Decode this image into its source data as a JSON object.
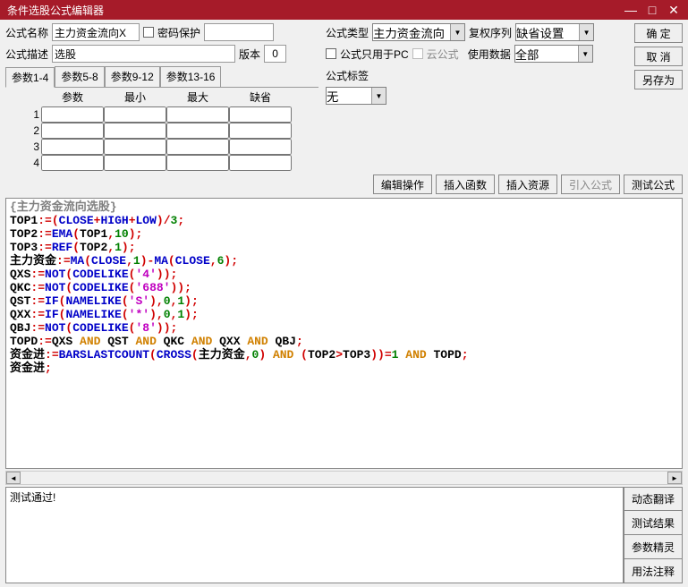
{
  "window": {
    "title": "条件选股公式编辑器"
  },
  "labels": {
    "formula_name": "公式名称",
    "pwd_protect": "密码保护",
    "formula_desc": "公式描述",
    "version": "版本",
    "formula_type": "公式类型",
    "restore_seq": "复权序列",
    "only_pc": "公式只用于PC",
    "cloud": "云公式",
    "use_data": "使用数据",
    "formula_tag": "公式标签",
    "param_cols": [
      "参数",
      "最小",
      "最大",
      "缺省"
    ],
    "tabs": [
      "参数1-4",
      "参数5-8",
      "参数9-12",
      "参数13-16"
    ],
    "row_nums": [
      "1",
      "2",
      "3",
      "4"
    ]
  },
  "values": {
    "formula_name": "主力资金流向X",
    "formula_desc": "选股",
    "version": "0",
    "formula_type": "主力资金流向",
    "restore_seq": "缺省设置",
    "use_data": "全部",
    "formula_tag": "无",
    "pwd_field": ""
  },
  "buttons": {
    "ok": "确 定",
    "cancel": "取 消",
    "save_as": "另存为",
    "edit_op": "编辑操作",
    "insert_func": "插入函数",
    "insert_res": "插入资源",
    "import_formula": "引入公式",
    "test_formula": "测试公式",
    "dyn_trans": "动态翻译",
    "test_result": "测试结果",
    "param_wizard": "参数精灵",
    "usage_note": "用法注释"
  },
  "status": {
    "msg": "测试通过!"
  },
  "code": {
    "title": "{主力资金流向选股}",
    "lines": [
      [
        [
          "black",
          "TOP1"
        ],
        [
          "red",
          ":="
        ],
        [
          "red",
          "("
        ],
        [
          "blue",
          "CLOSE"
        ],
        [
          "red",
          "+"
        ],
        [
          "blue",
          "HIGH"
        ],
        [
          "red",
          "+"
        ],
        [
          "blue",
          "LOW"
        ],
        [
          "red",
          ")"
        ],
        [
          "red",
          "/"
        ],
        [
          "green",
          "3"
        ],
        [
          "red",
          ";"
        ]
      ],
      [
        [
          "black",
          "TOP2"
        ],
        [
          "red",
          ":="
        ],
        [
          "blue",
          "EMA"
        ],
        [
          "red",
          "("
        ],
        [
          "black",
          "TOP1"
        ],
        [
          "red",
          ","
        ],
        [
          "green",
          "10"
        ],
        [
          "red",
          ")"
        ],
        [
          "red",
          ";"
        ]
      ],
      [
        [
          "black",
          "TOP3"
        ],
        [
          "red",
          ":="
        ],
        [
          "blue",
          "REF"
        ],
        [
          "red",
          "("
        ],
        [
          "black",
          "TOP2"
        ],
        [
          "red",
          ","
        ],
        [
          "green",
          "1"
        ],
        [
          "red",
          ")"
        ],
        [
          "red",
          ";"
        ]
      ],
      [
        [
          "black",
          "主力资金"
        ],
        [
          "red",
          ":="
        ],
        [
          "blue",
          "MA"
        ],
        [
          "red",
          "("
        ],
        [
          "blue",
          "CLOSE"
        ],
        [
          "red",
          ","
        ],
        [
          "green",
          "1"
        ],
        [
          "red",
          ")"
        ],
        [
          "red",
          "-"
        ],
        [
          "blue",
          "MA"
        ],
        [
          "red",
          "("
        ],
        [
          "blue",
          "CLOSE"
        ],
        [
          "red",
          ","
        ],
        [
          "green",
          "6"
        ],
        [
          "red",
          ")"
        ],
        [
          "red",
          ";"
        ]
      ],
      [
        [
          "black",
          "QXS"
        ],
        [
          "red",
          ":="
        ],
        [
          "blue",
          "NOT"
        ],
        [
          "red",
          "("
        ],
        [
          "blue",
          "CODELIKE"
        ],
        [
          "red",
          "("
        ],
        [
          "magenta",
          "'4'"
        ],
        [
          "red",
          ")"
        ],
        [
          "red",
          ")"
        ],
        [
          "red",
          ";"
        ]
      ],
      [
        [
          "black",
          "QKC"
        ],
        [
          "red",
          ":="
        ],
        [
          "blue",
          "NOT"
        ],
        [
          "red",
          "("
        ],
        [
          "blue",
          "CODELIKE"
        ],
        [
          "red",
          "("
        ],
        [
          "magenta",
          "'688'"
        ],
        [
          "red",
          ")"
        ],
        [
          "red",
          ")"
        ],
        [
          "red",
          ";"
        ]
      ],
      [
        [
          "black",
          "QST"
        ],
        [
          "red",
          ":="
        ],
        [
          "blue",
          "IF"
        ],
        [
          "red",
          "("
        ],
        [
          "blue",
          "NAMELIKE"
        ],
        [
          "red",
          "("
        ],
        [
          "magenta",
          "'S'"
        ],
        [
          "red",
          ")"
        ],
        [
          "red",
          ","
        ],
        [
          "green",
          "0"
        ],
        [
          "red",
          ","
        ],
        [
          "green",
          "1"
        ],
        [
          "red",
          ")"
        ],
        [
          "red",
          ";"
        ]
      ],
      [
        [
          "black",
          "QXX"
        ],
        [
          "red",
          ":="
        ],
        [
          "blue",
          "IF"
        ],
        [
          "red",
          "("
        ],
        [
          "blue",
          "NAMELIKE"
        ],
        [
          "red",
          "("
        ],
        [
          "magenta",
          "'*'"
        ],
        [
          "red",
          ")"
        ],
        [
          "red",
          ","
        ],
        [
          "green",
          "0"
        ],
        [
          "red",
          ","
        ],
        [
          "green",
          "1"
        ],
        [
          "red",
          ")"
        ],
        [
          "red",
          ";"
        ]
      ],
      [
        [
          "black",
          "QBJ"
        ],
        [
          "red",
          ":="
        ],
        [
          "blue",
          "NOT"
        ],
        [
          "red",
          "("
        ],
        [
          "blue",
          "CODELIKE"
        ],
        [
          "red",
          "("
        ],
        [
          "magenta",
          "'8'"
        ],
        [
          "red",
          ")"
        ],
        [
          "red",
          ")"
        ],
        [
          "red",
          ";"
        ]
      ],
      [
        [
          "black",
          "TOPD"
        ],
        [
          "red",
          ":="
        ],
        [
          "black",
          "QXS "
        ],
        [
          "orange",
          "AND"
        ],
        [
          "black",
          " QST "
        ],
        [
          "orange",
          "AND"
        ],
        [
          "black",
          " QKC "
        ],
        [
          "orange",
          "AND"
        ],
        [
          "black",
          " QXX "
        ],
        [
          "orange",
          "AND"
        ],
        [
          "black",
          " QBJ"
        ],
        [
          "red",
          ";"
        ]
      ],
      [
        [
          "black",
          "资金进"
        ],
        [
          "red",
          ":="
        ],
        [
          "blue",
          "BARSLASTCOUNT"
        ],
        [
          "red",
          "("
        ],
        [
          "blue",
          "CROSS"
        ],
        [
          "red",
          "("
        ],
        [
          "black",
          "主力资金"
        ],
        [
          "red",
          ","
        ],
        [
          "green",
          "0"
        ],
        [
          "red",
          ")"
        ],
        [
          "black",
          " "
        ],
        [
          "orange",
          "AND"
        ],
        [
          "black",
          " "
        ],
        [
          "red",
          "("
        ],
        [
          "black",
          "TOP2"
        ],
        [
          "red",
          ">"
        ],
        [
          "black",
          "TOP3"
        ],
        [
          "red",
          ")"
        ],
        [
          "red",
          ")"
        ],
        [
          "red",
          "="
        ],
        [
          "green",
          "1"
        ],
        [
          "black",
          " "
        ],
        [
          "orange",
          "AND"
        ],
        [
          "black",
          " TOPD"
        ],
        [
          "red",
          ";"
        ]
      ],
      [
        [
          "black",
          "资金进"
        ],
        [
          "red",
          ";"
        ]
      ]
    ]
  }
}
